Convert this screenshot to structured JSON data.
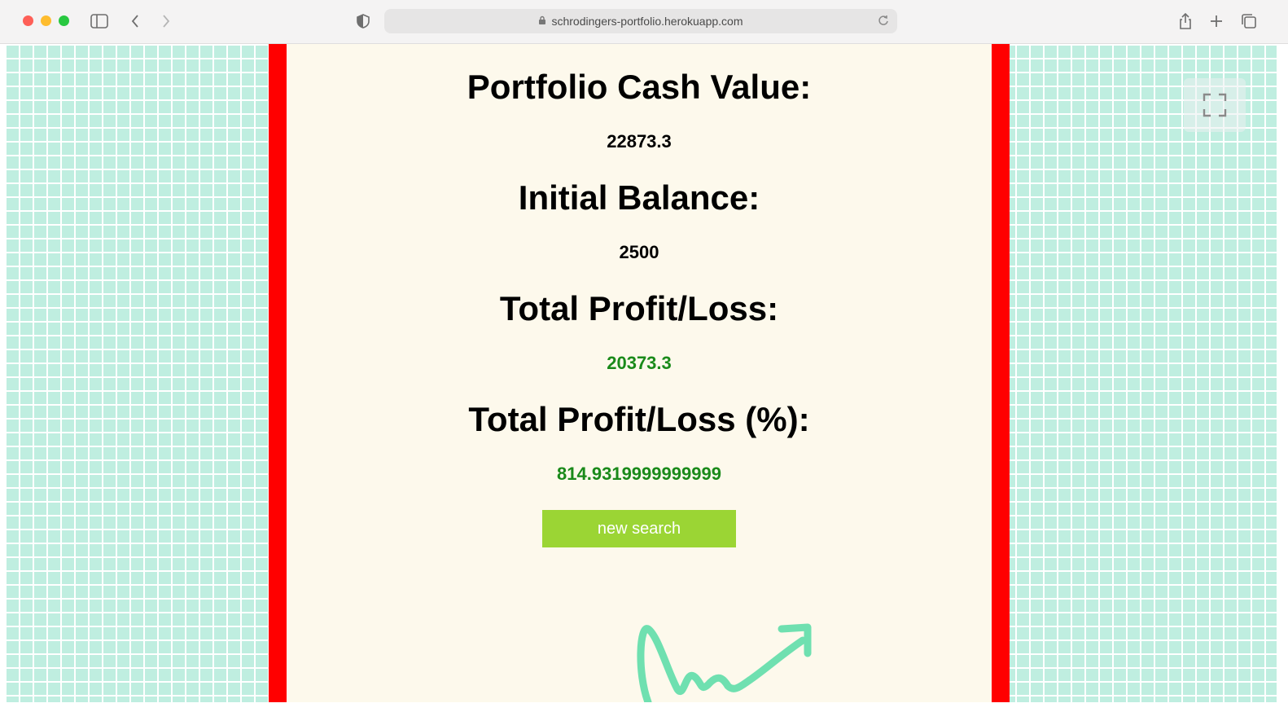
{
  "browser": {
    "url": "schrodingers-portfolio.herokuapp.com"
  },
  "portfolio": {
    "cash_value_label": "Portfolio Cash Value:",
    "cash_value": "22873.3",
    "initial_balance_label": "Initial Balance:",
    "initial_balance": "2500",
    "profit_loss_label": "Total Profit/Loss:",
    "profit_loss": "20373.3",
    "profit_loss_pct_label": "Total Profit/Loss (%):",
    "profit_loss_pct": "814.9319999999999",
    "new_search_label": "new search"
  },
  "colors": {
    "panel_border": "#ff0000",
    "positive_value": "#1a8a1a",
    "button_bg": "#9bd534",
    "doodle_arrow": "#6fe0b0"
  }
}
